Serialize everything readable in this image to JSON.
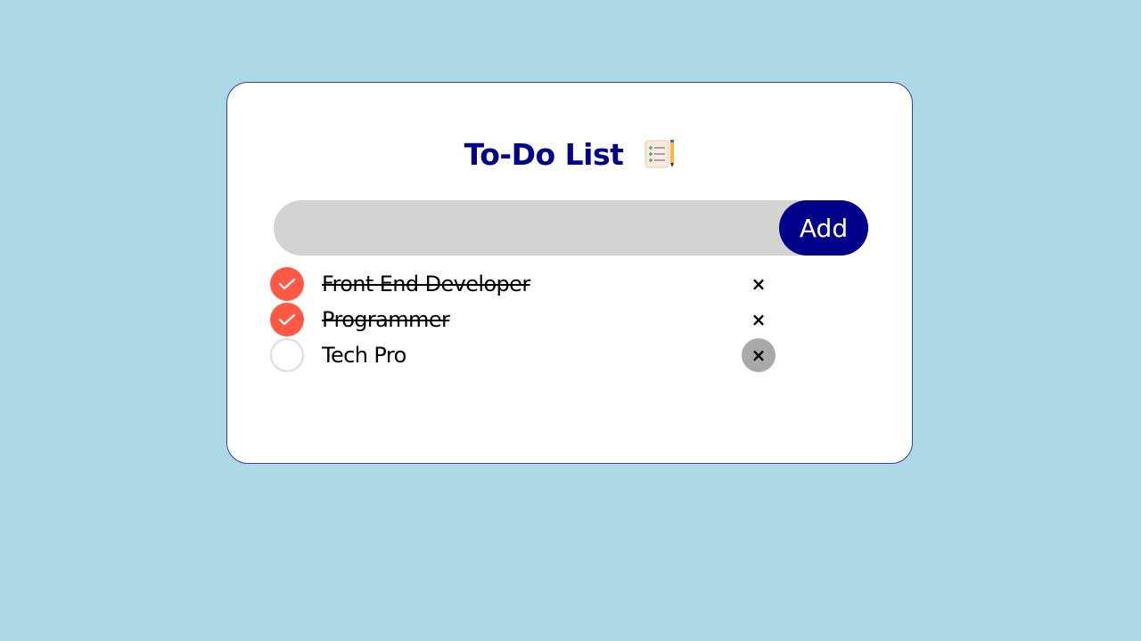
{
  "app": {
    "title": "To-Do List",
    "title_icon": "notepad-pencil-icon"
  },
  "input": {
    "value": "",
    "placeholder": "",
    "add_label": "Add"
  },
  "tasks": [
    {
      "text": "Front End Developer",
      "done": true,
      "delete_label": "×"
    },
    {
      "text": "Programmer",
      "done": true,
      "delete_label": "×"
    },
    {
      "text": "Tech Pro",
      "done": false,
      "delete_label": "×"
    }
  ],
  "colors": {
    "background": "#add8e6",
    "accent": "#00008b",
    "checked": "#ff5945",
    "input_bg": "#d3d3d3",
    "delete_hover": "#a9a9a9"
  }
}
